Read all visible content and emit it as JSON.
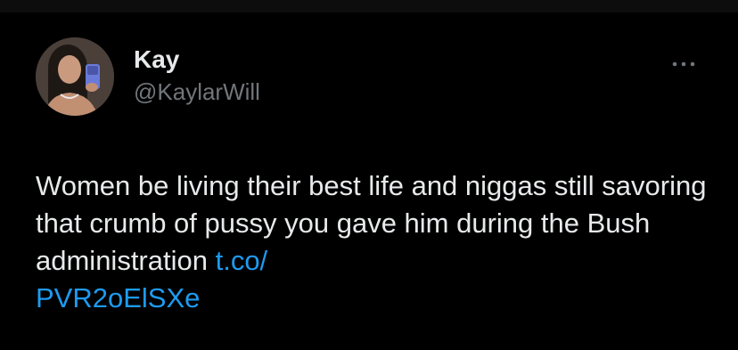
{
  "author": {
    "display_name": "Kay",
    "handle": "@KaylarWill",
    "avatar_icon": "profile-photo"
  },
  "more_icon": "ellipsis-icon",
  "tweet": {
    "text": "Women be living their best life and niggas still savoring that crumb of pussy you gave him during the Bush administration ",
    "link_line1": "t.co/",
    "link_line2": "PVR2oElSXe"
  },
  "colors": {
    "background": "#000000",
    "text": "#e7e9ea",
    "secondary_text": "#71767b",
    "link": "#1d9bf0"
  }
}
